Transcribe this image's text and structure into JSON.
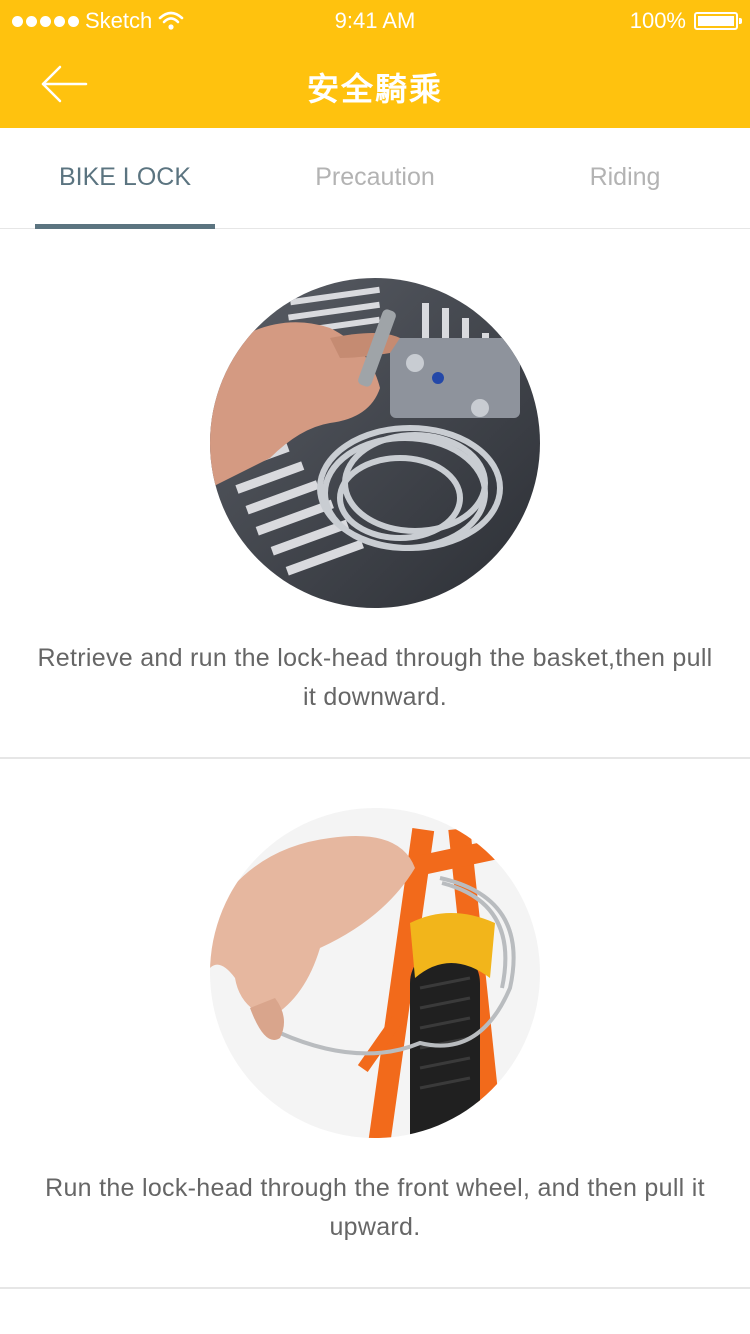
{
  "status_bar": {
    "carrier": "Sketch",
    "time": "9:41 AM",
    "battery": "100%"
  },
  "navbar": {
    "title": "安全騎乘",
    "back_icon": "arrow-left-icon"
  },
  "tabs": [
    {
      "label": "BIKE LOCK",
      "active": true
    },
    {
      "label": "Precaution",
      "active": false
    },
    {
      "label": "Riding",
      "active": false
    }
  ],
  "steps": [
    {
      "image": "cable-lock-basket-photo",
      "caption": "Retrieve and run the lock-head through the basket,then pull it downward."
    },
    {
      "image": "cable-lock-front-wheel-photo",
      "caption": "Run the lock-head through the front wheel, and then pull it upward."
    }
  ],
  "colors": {
    "brand": "#FFC20E",
    "tab_active": "#5b7480",
    "tab_inactive": "#b3b3b3"
  }
}
